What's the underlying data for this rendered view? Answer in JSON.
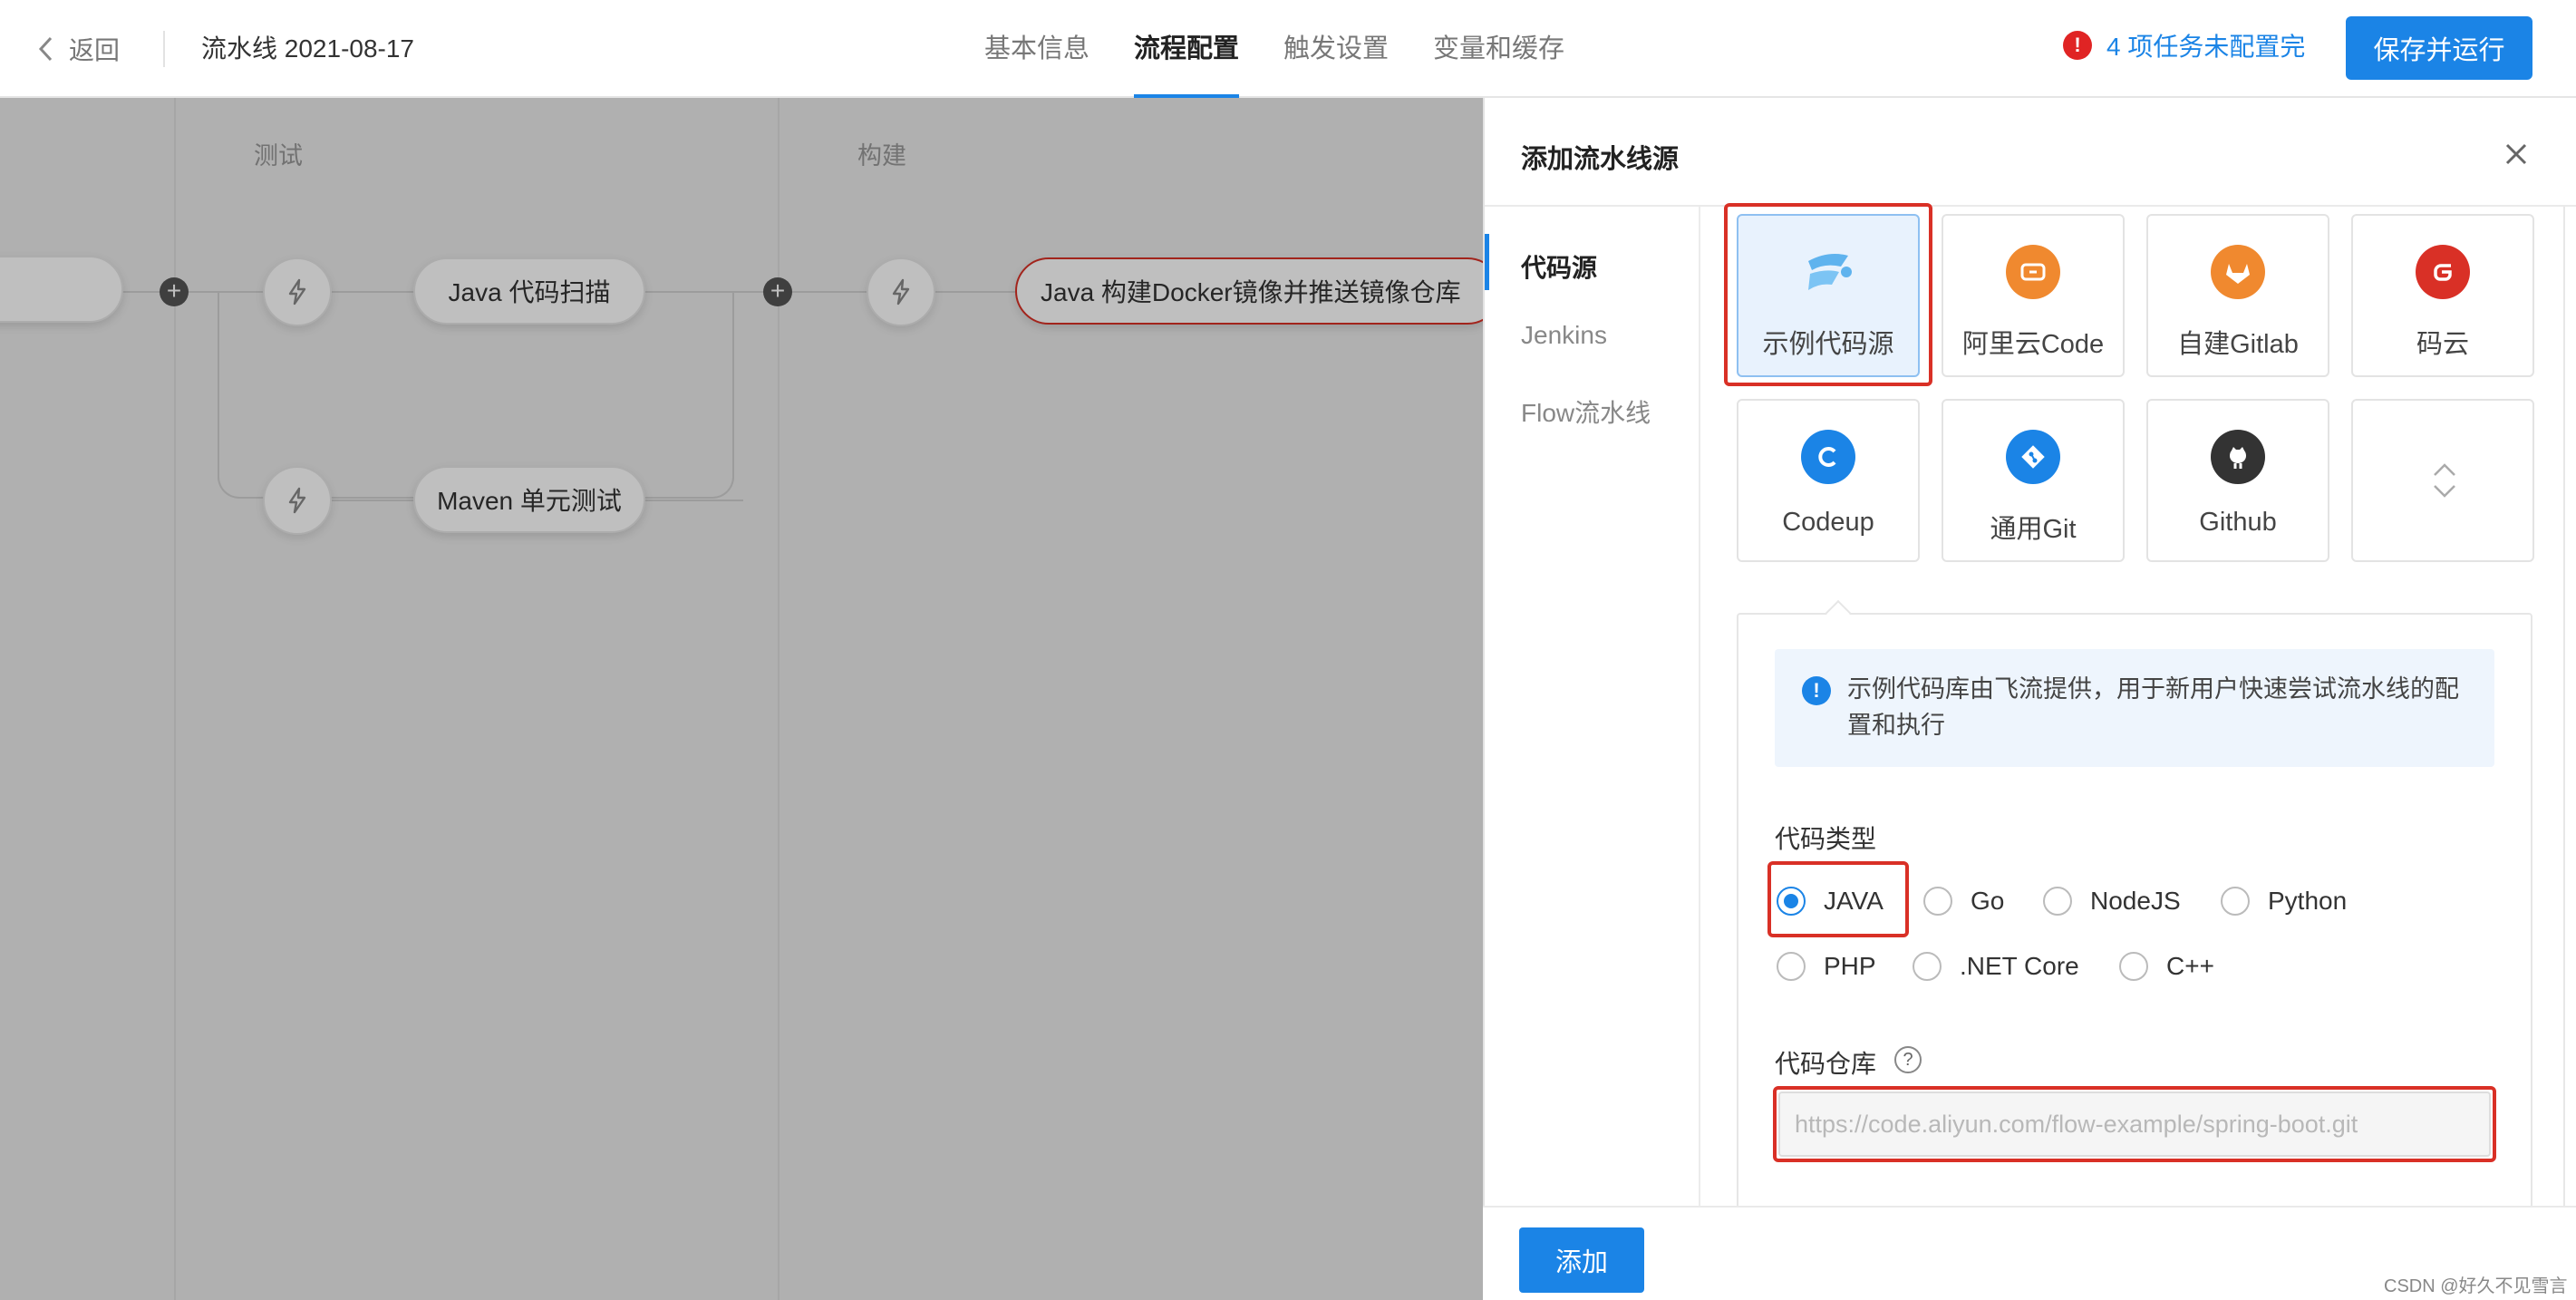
{
  "header": {
    "back_label": "返回",
    "pipeline_title": "流水线 2021-08-17",
    "tabs": [
      {
        "label": "基本信息"
      },
      {
        "label": "流程配置"
      },
      {
        "label": "触发设置"
      },
      {
        "label": "变量和缓存"
      }
    ],
    "active_tab": "流程配置",
    "warning_icon": "!",
    "warning_text": "4 项任务未配置完",
    "save_run_label": "保存并运行"
  },
  "canvas": {
    "stages": [
      {
        "label": "测试"
      },
      {
        "label": "构建"
      }
    ],
    "jobs": {
      "code_scan": "Java 代码扫描",
      "unit_test": "Maven 单元测试",
      "docker_build": "Java 构建Docker镜像并推送镜像仓库"
    },
    "plus_symbol": "+"
  },
  "drawer": {
    "title": "添加流水线源",
    "nav": [
      {
        "label": "代码源"
      },
      {
        "label": "Jenkins"
      },
      {
        "label": "Flow流水线"
      }
    ],
    "sources": [
      {
        "label": "示例代码源",
        "icon": "sample-source-icon"
      },
      {
        "label": "阿里云Code",
        "icon": "aliyun-code-icon",
        "color": "#f0892f"
      },
      {
        "label": "自建Gitlab",
        "icon": "gitlab-icon",
        "color": "#f0892f"
      },
      {
        "label": "码云",
        "icon": "gitee-icon",
        "color": "#d93026"
      },
      {
        "label": "Codeup",
        "icon": "codeup-icon",
        "color": "#1b84e6"
      },
      {
        "label": "通用Git",
        "icon": "git-icon",
        "color": "#1b84e6"
      },
      {
        "label": "Github",
        "icon": "github-icon",
        "color": "#333333"
      }
    ],
    "notice_icon": "!",
    "notice": "示例代码库由飞流提供，用于新用户快速尝试流水线的配置和执行",
    "code_type_label": "代码类型",
    "code_types": [
      {
        "label": "JAVA",
        "checked": true
      },
      {
        "label": "Go"
      },
      {
        "label": "NodeJS"
      },
      {
        "label": "Python"
      },
      {
        "label": "PHP"
      },
      {
        "label": ".NET Core"
      },
      {
        "label": "C++"
      }
    ],
    "repo_label": "代码仓库",
    "help_symbol": "?",
    "repo_placeholder": "https://code.aliyun.com/flow-example/spring-boot.git",
    "add_label": "添加"
  },
  "watermark": "CSDN @好久不见雪言",
  "colors": {
    "accent": "#1b84e6",
    "error": "#d93026"
  }
}
